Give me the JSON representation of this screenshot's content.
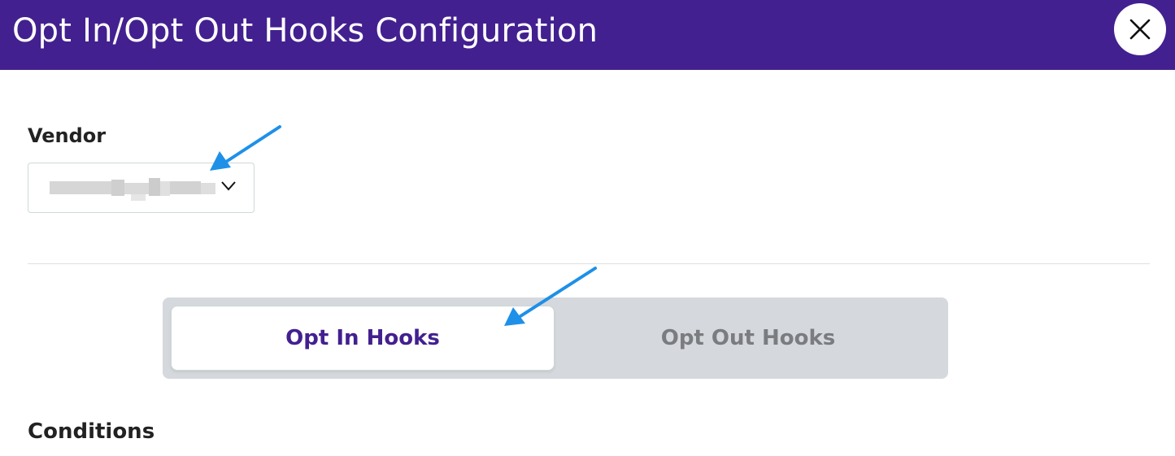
{
  "header": {
    "title": "Opt In/Opt Out Hooks Configuration",
    "close_icon": "close-icon",
    "background_color": "#43208f"
  },
  "vendor": {
    "label": "Vendor",
    "selected_value_redacted": true,
    "dropdown_icon": "chevron-down-icon"
  },
  "tabs": [
    {
      "label": "Opt In Hooks",
      "active": true
    },
    {
      "label": "Opt Out Hooks",
      "active": false
    }
  ],
  "conditions": {
    "label": "Conditions"
  },
  "annotations": {
    "arrow_color": "#1e90e8",
    "arrow_icon": "arrow-pointer-icon"
  }
}
